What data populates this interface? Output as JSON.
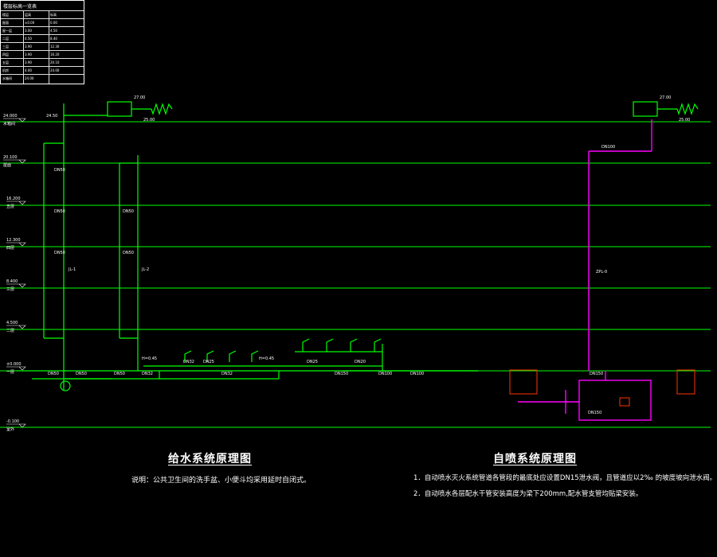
{
  "legend_table": {
    "title": "楼层标高一览表",
    "header": [
      "楼层",
      "层高",
      "标高"
    ],
    "rows": [
      [
        "屋面",
        "±0.00",
        "0.00"
      ],
      [
        "屋一层",
        "3.00",
        "4.50"
      ],
      [
        "二层",
        "4.50",
        "8.40"
      ],
      [
        "三层",
        "3.90",
        "12.30"
      ],
      [
        "四层",
        "3.90",
        "16.20"
      ],
      [
        "五层",
        "3.90",
        "20.10"
      ],
      [
        "机房",
        "4.00",
        "24.00"
      ],
      [
        "水箱间",
        "24.00",
        ""
      ]
    ]
  },
  "elevations": [
    "24.000",
    "20.100",
    "16.200",
    "12.300",
    "8.400",
    "4.500",
    "±0.000",
    "-0.100"
  ],
  "elevation_tags": [
    "水箱间",
    "屋面",
    "五层",
    "四层",
    "三层",
    "二层",
    "一层",
    "室外"
  ],
  "pipe_labels": {
    "dn50": "DN50",
    "dn32": "DN32",
    "dn25": "DN25",
    "dn20": "DN20",
    "dn100": "DN100",
    "dn150": "DN150",
    "dn15": "DN15",
    "jl1": "JL-1",
    "jl2": "JL-2",
    "zpl0": "ZPL-0",
    "h050": "H=0.45"
  },
  "tank_levels": {
    "left_top": "27.00",
    "left_mid": "24.50",
    "left_bot": "25.00",
    "right_top": "27.00",
    "right_bot": "25.00"
  },
  "diagram_left": {
    "title": "给水系统原理图",
    "note": "说明：公共卫生间的洗手盆、小便斗均采用延时自闭式。"
  },
  "diagram_right": {
    "title": "自喷系统原理图",
    "notes": [
      "1．自动喷水灭火系统管道各管段的最底处应设置DN15泄水阀，且管道应以2‰ 的坡度坡向泄水阀。",
      "2．自动喷水各层配水干管安装高度为梁下200mm,配水管支管均贴梁安装。"
    ]
  },
  "colors": {
    "background": "#000000",
    "water_pipe": "#00ff00",
    "sprinkler_pipe": "#ff00ff",
    "equipment": "#ff3300",
    "text": "#ffffff",
    "floor_line": "#00ff00"
  }
}
